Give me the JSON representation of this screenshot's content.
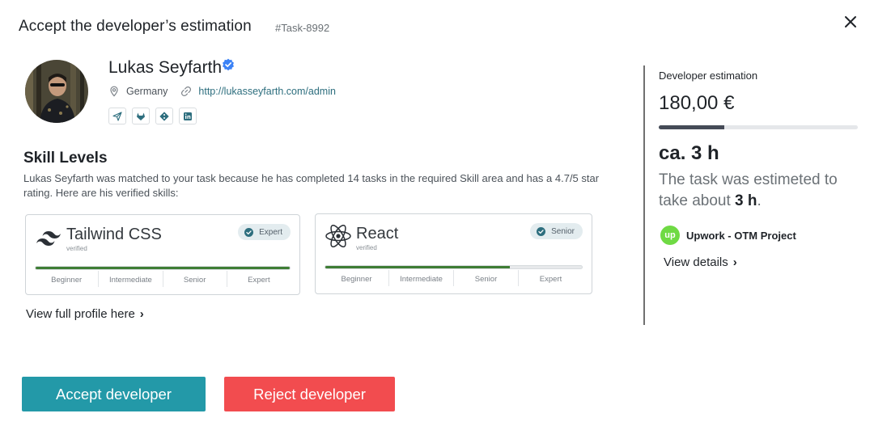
{
  "modal": {
    "title": "Accept the developer’s estimation",
    "task_id": "#Task-8992",
    "close_icon": "close-icon"
  },
  "developer": {
    "name": "Lukas Seyfarth",
    "location": "Germany",
    "url": "http://lukasseyfarth.com/admin",
    "social_icons": [
      "send-icon",
      "gitlab-icon",
      "git-icon",
      "linkedin-icon"
    ]
  },
  "skills": {
    "heading": "Skill Levels",
    "description": "Lukas Seyfarth was matched to your task because he has completed 14 tasks in the required Skill area and has a 4.7/5 star rating. Here are his verified skills:",
    "levels": [
      "Beginner",
      "Intermediate",
      "Senior",
      "Expert"
    ],
    "cards": [
      {
        "name": "Tailwind CSS",
        "sub": "verified",
        "badge": "Expert",
        "level_fraction": 1.0,
        "logo": "tailwind-logo"
      },
      {
        "name": "React",
        "sub": "verified",
        "badge": "Senior",
        "level_fraction": 0.72,
        "logo": "react-logo"
      }
    ],
    "view_profile": "View full profile here"
  },
  "estimation": {
    "label": "Developer estimation",
    "price": "180,00 €",
    "progress_fraction": 0.33,
    "hours": "ca. 3 h",
    "text_prefix": "The task was estimeted to take about",
    "text_bold": "3 h",
    "text_suffix": ".",
    "project_icon": "upwork-icon",
    "project_icon_text": "up",
    "project": "Upwork - OTM Project",
    "view_details": "View details"
  },
  "actions": {
    "accept": "Accept developer",
    "reject": "Reject developer"
  },
  "colors": {
    "accept": "#2399a8",
    "reject": "#f24c4f",
    "skill_fill": "#3e7d34",
    "estimate_fill": "#454b57",
    "upwork": "#6fda44"
  }
}
